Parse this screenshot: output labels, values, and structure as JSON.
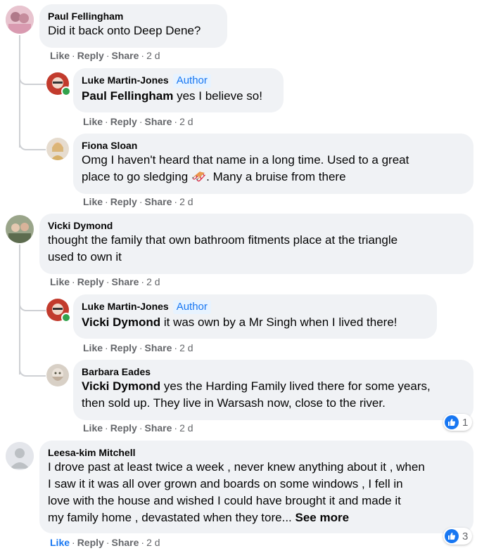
{
  "comments": [
    {
      "name": "Paul Fellingham",
      "text": "Did it back onto Deep Dene?",
      "actions": {
        "like": "Like",
        "reply": "Reply",
        "share": "Share",
        "time": "2 d"
      }
    },
    {
      "name": "Luke Martin-Jones",
      "badge": "Author",
      "mention": "Paul Fellingham",
      "text": " yes I believe so!",
      "actions": {
        "like": "Like",
        "reply": "Reply",
        "share": "Share",
        "time": "2 d"
      }
    },
    {
      "name": "Fiona Sloan",
      "line1": "Omg I haven't heard that name in a long time. Used to a great",
      "line2a": "place to go sledging ",
      "emoji": "🛷",
      "line2b": ". Many a bruise from there",
      "actions": {
        "like": "Like",
        "reply": "Reply",
        "share": "Share",
        "time": "2 d"
      }
    },
    {
      "name": "Vicki Dymond",
      "line1": "thought the family that own bathroom fitments place at the triangle",
      "line2": "used to own it",
      "actions": {
        "like": "Like",
        "reply": "Reply",
        "share": "Share",
        "time": "2 d"
      }
    },
    {
      "name": "Luke Martin-Jones",
      "badge": "Author",
      "mention": "Vicki Dymond",
      "text": " it was own by a Mr Singh when I lived there!",
      "actions": {
        "like": "Like",
        "reply": "Reply",
        "share": "Share",
        "time": "2 d"
      }
    },
    {
      "name": "Barbara Eades",
      "mention": "Vicki Dymond",
      "line1": " yes the Harding Family lived there for some years,",
      "line2": "then sold up. They live in Warsash now, close to the river.",
      "actions": {
        "like": "Like",
        "reply": "Reply",
        "share": "Share",
        "time": "2 d"
      },
      "reactions": "1"
    },
    {
      "name": "Leesa-kim Mitchell",
      "line1": "I drove past at least twice a week , never knew anything about it , when",
      "line2": "I saw it it was all over grown and boards on some windows , I fell in",
      "line3": "love with the house and wished I could have brought it and made it",
      "line4": "my family home , devastated when they tore... ",
      "seemore": "See more",
      "actions": {
        "like": "Like",
        "reply": "Reply",
        "share": "Share",
        "time": "2 d"
      },
      "reactions": "3"
    }
  ],
  "colors": {
    "bubble": "#f0f2f5",
    "accent": "#1877f2",
    "meta": "#65676b"
  }
}
